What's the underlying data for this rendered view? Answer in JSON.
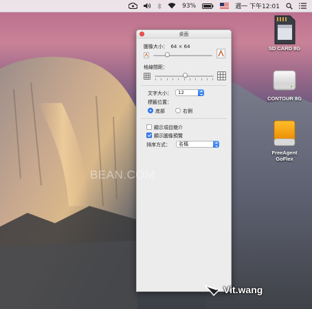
{
  "menubar": {
    "battery": "93%",
    "clock": "週一 下午12:01",
    "icons": [
      "creative-cloud-icon",
      "volume-icon",
      "bluetooth-icon",
      "wifi-icon",
      "battery-icon",
      "flag-icon",
      "search-icon",
      "list-icon"
    ]
  },
  "window": {
    "title": "桌面",
    "icon_size_label": "圖像大小：",
    "icon_size_value": "64 × 64",
    "grid_spacing_label": "格線間距：",
    "text_size_label": "文字大小：",
    "text_size_value": "12",
    "label_position_label": "標籤位置：",
    "label_bottom": "底部",
    "label_right": "右側",
    "label_position_selected": "bottom",
    "show_item_info": "顯示項目簡介",
    "show_item_info_checked": false,
    "show_icon_preview": "顯示圖像預覽",
    "show_icon_preview_checked": true,
    "sort_by_label": "排序方式：",
    "sort_by_value": "名稱",
    "icon_size_level": 0.24,
    "grid_spacing_level": 0.52
  },
  "desktop": {
    "drives": [
      {
        "label": "SD CARD 8G",
        "icon": "sd-card-icon"
      },
      {
        "label": "CONTOUR 8G",
        "icon": "external-drive-icon"
      },
      {
        "label": "FreeAgent\nGoFlex",
        "icon": "orange-drive-icon"
      }
    ],
    "watermark_center": "BEAN.COM",
    "watermark_signature": "Vit.wang"
  },
  "colors": {
    "accent": "#3b82f1",
    "close": "#f2544e"
  }
}
